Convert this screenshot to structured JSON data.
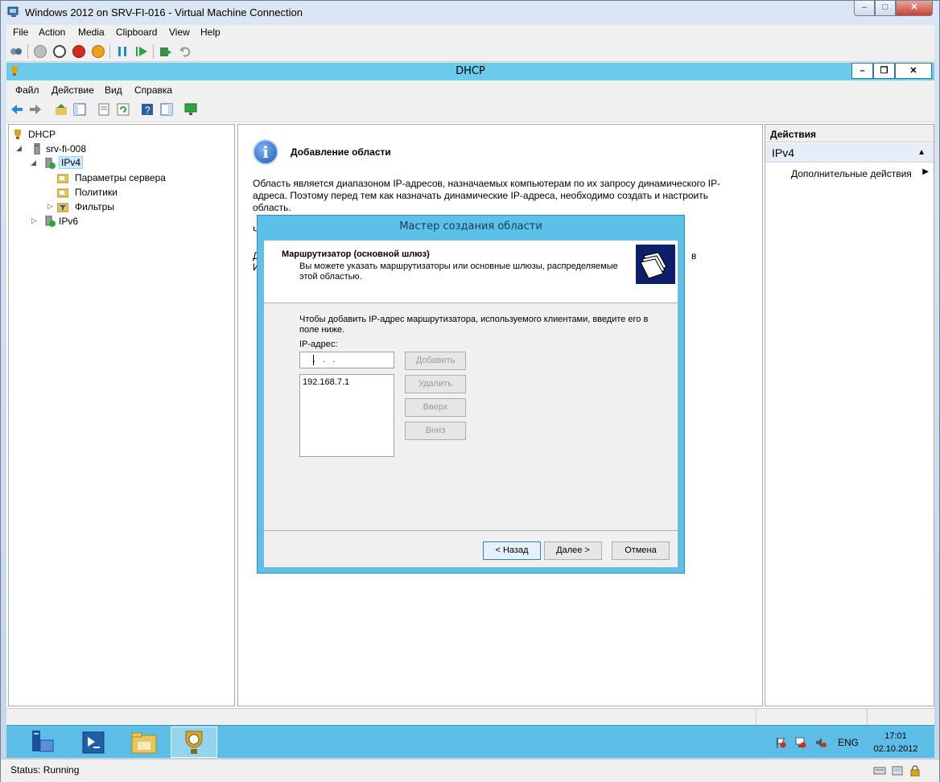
{
  "host_window": {
    "title": "Windows 2012 on SRV-FI-016 - Virtual Machine Connection",
    "menu": [
      "File",
      "Action",
      "Media",
      "Clipboard",
      "View",
      "Help"
    ],
    "status_text": "Status: Running"
  },
  "mmc": {
    "title": "DHCP",
    "menu": [
      "Файл",
      "Действие",
      "Вид",
      "Справка"
    ],
    "tree": {
      "root": "DHCP",
      "server": "srv-fi-008",
      "ipv4": "IPv4",
      "server_options": "Параметры сервера",
      "policies": "Политики",
      "filters": "Фильтры",
      "ipv6": "IPv6"
    },
    "center": {
      "heading": "Добавление области",
      "paragraph": "Область является диапазоном IP-адресов, назначаемых компьютерам по их запросу динамического IP-адреса. Поэтому перед тем как назначать динамические IP-адреса, необходимо создать и настроить область.",
      "frag_ch": "Ч",
      "frag_d": "Д",
      "frag_i": "И",
      "frag_v": "в"
    },
    "actions": {
      "header": "Действия",
      "group": "IPv4",
      "item": "Дополнительные действия"
    }
  },
  "wizard": {
    "title": "Мастер создания области",
    "header_title": "Маршрутизатор (основной шлюз)",
    "header_subtitle": "Вы можете указать маршрутизаторы или основные шлюзы, распределяемые этой областью.",
    "instruction": "Чтобы добавить IP-адрес маршрутизатора, используемого клиентами, введите его в поле ниже.",
    "ip_label": "IP-адрес:",
    "ip_value": ". . .",
    "list_items": [
      "192.168.7.1"
    ],
    "buttons": {
      "add": "Добавить",
      "remove": "Удалить",
      "up": "Вверх",
      "down": "Вниз"
    },
    "nav": {
      "back": "< Назад",
      "next": "Далее >",
      "cancel": "Отмена"
    }
  },
  "taskbar": {
    "language": "ENG",
    "time": "17:01",
    "date": "02.10.2012"
  },
  "colors": {
    "accent": "#5cc1e8",
    "taskbar": "#5cbde6"
  }
}
